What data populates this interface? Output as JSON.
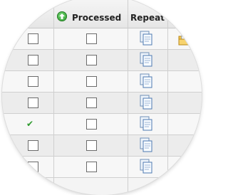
{
  "header": {
    "processed_label": "Processed",
    "repeat_label": "Repeat",
    "processed_sort_icon": "sort-green-icon"
  },
  "rows": [
    {
      "selected": false,
      "processed": false,
      "repeat_icon": "document-copy-icon",
      "extra_icon": "folder-envelope-icon"
    },
    {
      "selected": false,
      "processed": false,
      "repeat_icon": "document-copy-icon"
    },
    {
      "selected": false,
      "processed": false,
      "repeat_icon": "document-copy-icon"
    },
    {
      "selected": false,
      "processed": false,
      "repeat_icon": "document-copy-icon"
    },
    {
      "selected": true,
      "processed": false,
      "repeat_icon": "document-copy-icon"
    },
    {
      "selected": false,
      "processed": false,
      "repeat_icon": "document-copy-icon"
    },
    {
      "selected": false,
      "processed": false,
      "repeat_icon": "document-copy-icon"
    }
  ],
  "colors": {
    "check": "#2e9a2e",
    "row_alt": "#ececec",
    "row_base": "#f7f7f7",
    "header_bg": "#e6e6e6"
  }
}
